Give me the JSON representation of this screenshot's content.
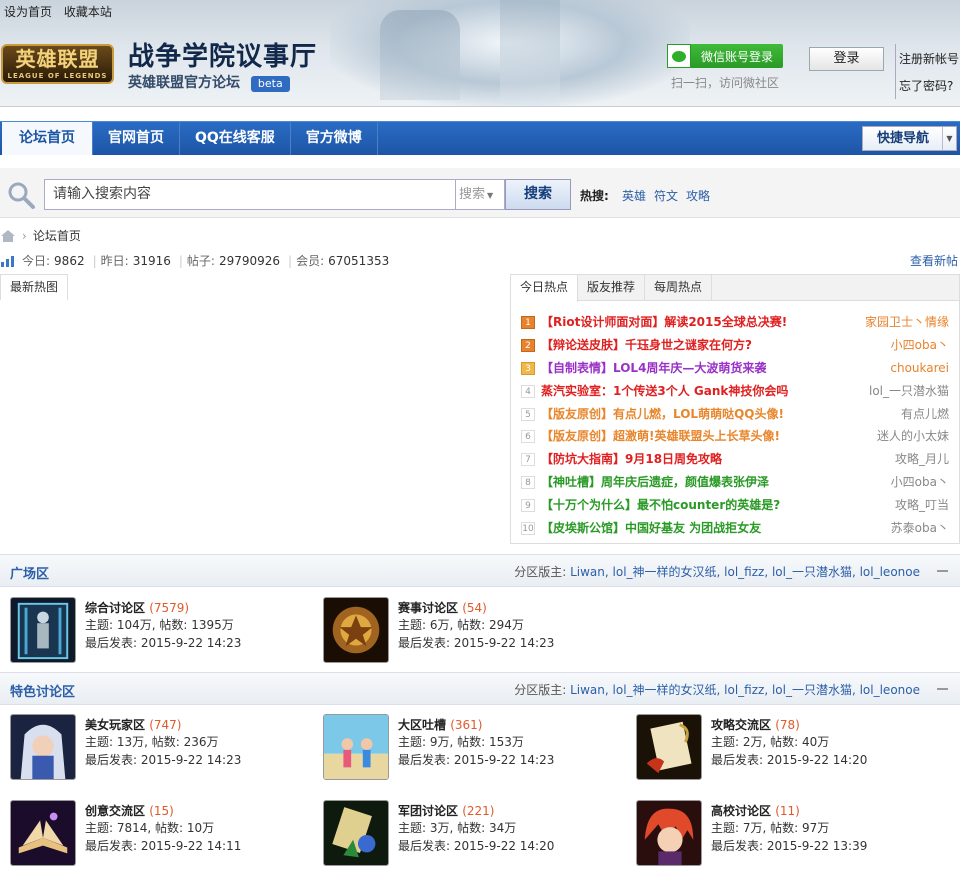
{
  "header": {
    "set_home": "设为首页",
    "bookmark": "收藏本站",
    "logo_text": "英雄联盟",
    "logo_sub": "LEAGUE OF LEGENDS",
    "site_title": "战争学院议事厅",
    "site_subtitle": "英雄联盟官方论坛",
    "beta": "beta",
    "wechat_login": "微信账号登录",
    "wechat_sub": "扫一扫，访问微社区",
    "login": "登录",
    "register": "注册新帐号",
    "forgot": "忘了密码?"
  },
  "nav": {
    "items": [
      "论坛首页",
      "官网首页",
      "QQ在线客服",
      "官方微博"
    ],
    "quick_nav": "快捷导航"
  },
  "search": {
    "placeholder": "请输入搜索内容",
    "type": "搜索",
    "button": "搜索",
    "hot_label": "热搜:",
    "hot_words": [
      "英雄",
      "符文",
      "攻略"
    ]
  },
  "breadcrumb": {
    "home": "论坛首页"
  },
  "stats": {
    "today_label": "今日:",
    "today": "9862",
    "yesterday_label": "昨日:",
    "yesterday": "31916",
    "posts_label": "帖子:",
    "posts": "29790926",
    "members_label": "会员:",
    "members": "67051353",
    "new_posts_link": "查看新帖"
  },
  "left_tab": "最新热图",
  "hot_tabs": [
    "今日热点",
    "版友推荐",
    "每周热点"
  ],
  "hot_list": [
    {
      "num": "1",
      "title": "【Riot设计师面对面】解读2015全球总决赛!",
      "author": "家园卫士丶情缘",
      "color": "#e02020",
      "acolor": "#e8822c"
    },
    {
      "num": "2",
      "title": "【辩论送皮肤】千珏身世之谜家在何方?",
      "author": "小四oba丶",
      "color": "#e02020",
      "acolor": "#e8822c"
    },
    {
      "num": "3",
      "title": "【自制表情】LOL4周年庆—大波萌货来袭",
      "author": "choukarei",
      "color": "#9a30c8",
      "acolor": "#e8822c"
    },
    {
      "num": "4",
      "title": "蒸汽实验室：1个传送3个人  Gank神技你会吗",
      "author": "lol_一只潜水猫",
      "color": "#e02020",
      "acolor": "#888888"
    },
    {
      "num": "5",
      "title": "【版友原创】有点儿燃，LOL萌萌哒QQ头像!",
      "author": "有点儿燃",
      "color": "#e8862c",
      "acolor": "#888888"
    },
    {
      "num": "6",
      "title": "【版友原创】超激萌!英雄联盟头上长草头像!",
      "author": "迷人的小太妹",
      "color": "#e8862c",
      "acolor": "#888888"
    },
    {
      "num": "7",
      "title": "【防坑大指南】9月18日周免攻略",
      "author": "攻略_月儿",
      "color": "#e02020",
      "acolor": "#888888"
    },
    {
      "num": "8",
      "title": "【神吐槽】周年庆后遗症，颜值爆表张伊泽",
      "author": "小四oba丶",
      "color": "#2a9a26",
      "acolor": "#888888"
    },
    {
      "num": "9",
      "title": "【十万个为什么】最不怕counter的英雄是?",
      "author": "攻略_叮当",
      "color": "#2a9a26",
      "acolor": "#888888"
    },
    {
      "num": "10",
      "title": "【皮埃斯公馆】中国好基友  为团战拒女友",
      "author": "苏泰oba丶",
      "color": "#2a9a26",
      "acolor": "#888888"
    }
  ],
  "zones": [
    {
      "title": "广场区",
      "moderators_label": "分区版主:",
      "moderators": "Liwan, lol_神一样的女汉纸, lol_fizz, lol_一只潜水猫, lol_leonoe",
      "forums": [
        {
          "name": "综合讨论区",
          "count": "(7579)",
          "stats": "主题: 104万, 帖数: 1395万",
          "last": "最后发表: 2015-9-22 14:23"
        },
        {
          "name": "赛事讨论区",
          "count": "(54)",
          "stats": "主题: 6万, 帖数: 294万",
          "last": "最后发表: 2015-9-22 14:23"
        }
      ]
    },
    {
      "title": "特色讨论区",
      "moderators_label": "分区版主:",
      "moderators": "Liwan, lol_神一样的女汉纸, lol_fizz, lol_一只潜水猫, lol_leonoe",
      "forums": [
        {
          "name": "美女玩家区",
          "count": "(747)",
          "stats": "主题: 13万, 帖数: 236万",
          "last": "最后发表: 2015-9-22 14:23"
        },
        {
          "name": "大区吐槽",
          "count": "(361)",
          "stats": "主题: 9万, 帖数: 153万",
          "last": "最后发表: 2015-9-22 14:23"
        },
        {
          "name": "攻略交流区",
          "count": "(78)",
          "stats": "主题: 2万, 帖数: 40万",
          "last": "最后发表: 2015-9-22 14:20"
        },
        {
          "name": "创意交流区",
          "count": "(15)",
          "stats": "主题: 7814, 帖数: 10万",
          "last": "最后发表: 2015-9-22 14:11"
        },
        {
          "name": "军团讨论区",
          "count": "(221)",
          "stats": "主题: 3万, 帖数: 34万",
          "last": "最后发表: 2015-9-22 14:20"
        },
        {
          "name": "高校讨论区",
          "count": "(11)",
          "stats": "主题: 7万, 帖数: 97万",
          "last": "最后发表: 2015-9-22 13:39"
        }
      ]
    }
  ]
}
